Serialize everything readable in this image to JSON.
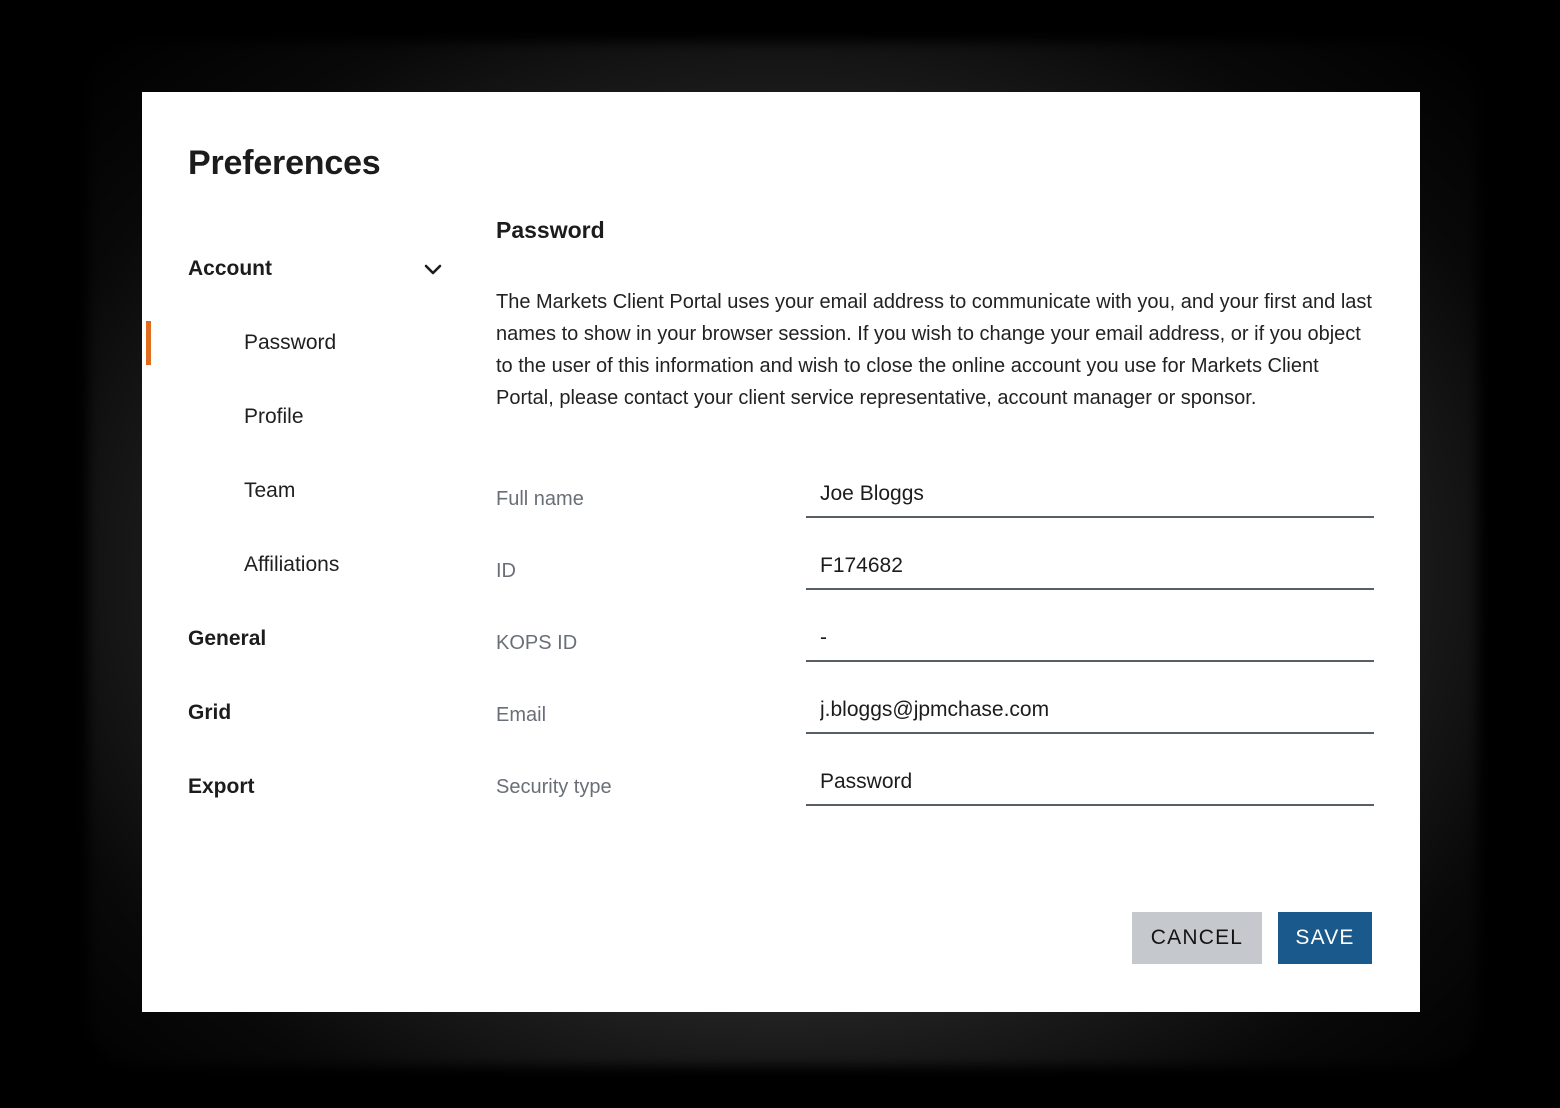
{
  "dialog": {
    "title": "Preferences"
  },
  "sidebar": {
    "groups": [
      {
        "label": "Account",
        "icon": "chevron-down-icon",
        "expanded": true,
        "children": [
          {
            "label": "Password",
            "active": true
          },
          {
            "label": "Profile",
            "active": false
          },
          {
            "label": "Team",
            "active": false
          },
          {
            "label": "Affiliations",
            "active": false
          }
        ]
      }
    ],
    "items": [
      {
        "label": "General"
      },
      {
        "label": "Grid"
      },
      {
        "label": "Export"
      }
    ],
    "active_indicator_color": "#E06C1E"
  },
  "main": {
    "section_title": "Password",
    "description": "The Markets Client Portal uses your email address to communicate with you, and your first and last names to show in your browser session. If you wish to change your email address, or if you object to the user of this information and wish to close the online account you use for Markets Client Portal, please contact your client service representative, account manager or sponsor.",
    "fields": [
      {
        "label": "Full name",
        "value": "Joe Bloggs",
        "placeholder": "Full name"
      },
      {
        "label": "ID",
        "value": "F174682",
        "placeholder": "ID"
      },
      {
        "label": "KOPS ID",
        "value": "-",
        "placeholder": "KOPS ID"
      },
      {
        "label": "Email",
        "value": "j.bloggs@jpmchase.com",
        "placeholder": "Email"
      },
      {
        "label": "Security type",
        "value": "Password",
        "placeholder": "Security type"
      }
    ]
  },
  "actions": {
    "cancel_label": "CANCEL",
    "save_label": "SAVE",
    "cancel_color": "#C5C9CE",
    "save_color": "#19598C"
  }
}
